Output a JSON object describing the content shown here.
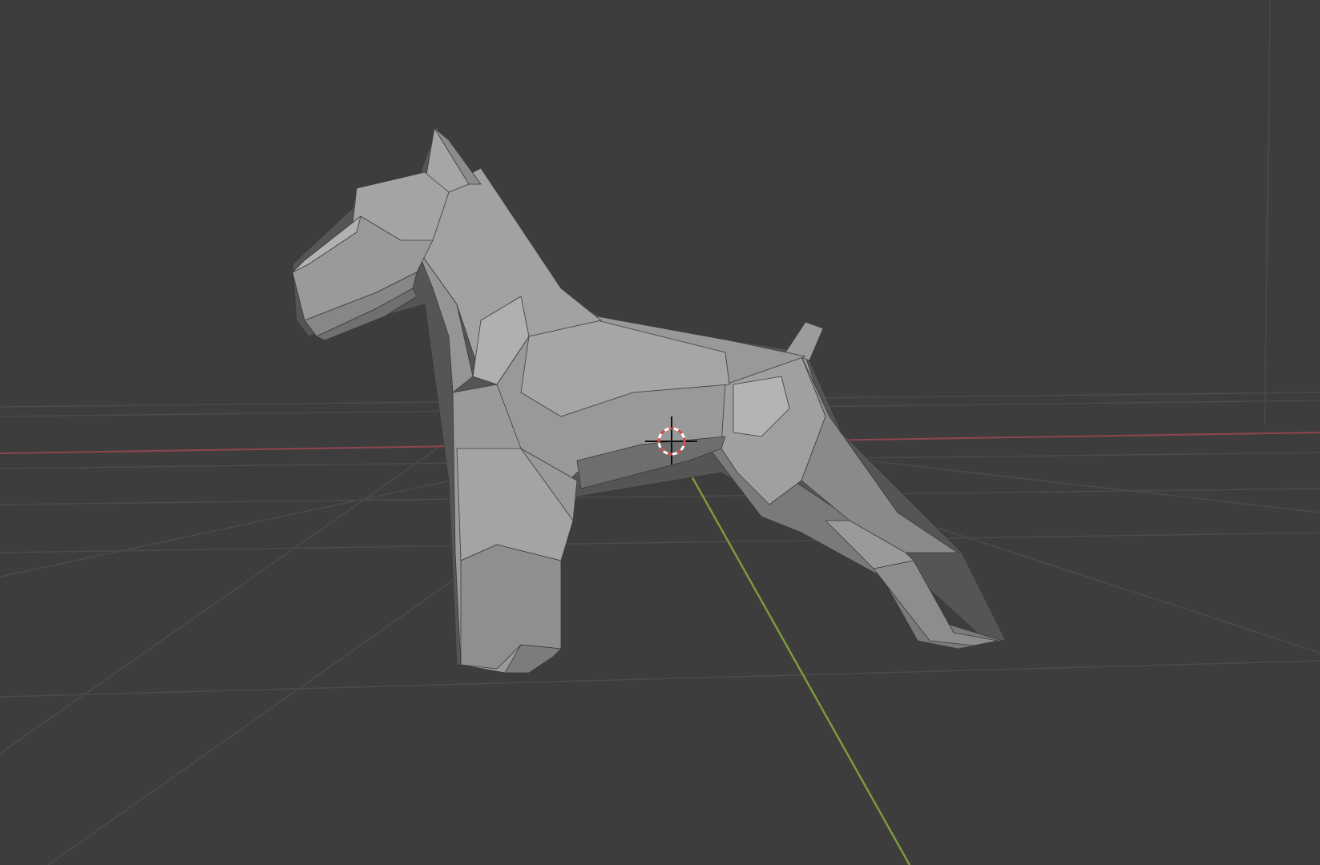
{
  "viewport": {
    "background": "#3d3d3d",
    "grid_color": "#4c4c4c",
    "x_axis_color": "#9a4a52",
    "y_axis_color": "#7a9a3a",
    "model_color": "#8e8e8e",
    "model_dark_color": "#5e5e5e",
    "model_light_color": "#a8a8a8",
    "cursor_ring_color_a": "#ffffff",
    "cursor_ring_color_b": "#d24848",
    "cursor_cross_color": "#111111"
  },
  "scene": {
    "object": "low-poly-dog-model",
    "cursor": "3d-cursor-icon"
  }
}
